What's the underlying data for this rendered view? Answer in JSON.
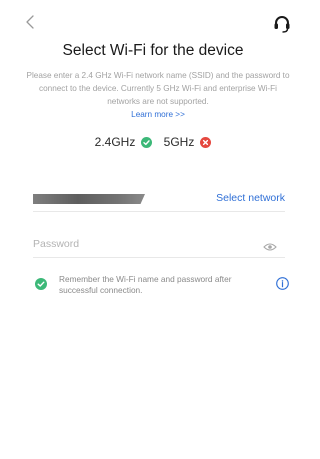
{
  "header": {
    "back_icon": "chevron-left-icon",
    "help_icon": "headset-icon"
  },
  "title": "Select Wi-Fi for the device",
  "description": "Please enter a 2.4 GHz Wi-Fi network name (SSID) and the password to connect to the device. Currently 5 GHz Wi-Fi and enterprise Wi-Fi networks are not supported.",
  "learn_more": "Learn more >>",
  "bands": [
    {
      "label": "2.4GHz",
      "supported": true,
      "color": "#3cb878"
    },
    {
      "label": "5GHz",
      "supported": false,
      "color": "#e5483f"
    }
  ],
  "ssid_field": {
    "value_redacted": true,
    "select_label": "Select network"
  },
  "password_field": {
    "placeholder": "Password",
    "toggle_icon": "eye-icon"
  },
  "remember": {
    "checked": true,
    "text": "Remember the Wi-Fi name and password after successful connection.",
    "info_icon": "info-icon"
  },
  "colors": {
    "accent": "#2f6fd6",
    "success": "#3cb878",
    "error": "#e5483f"
  }
}
